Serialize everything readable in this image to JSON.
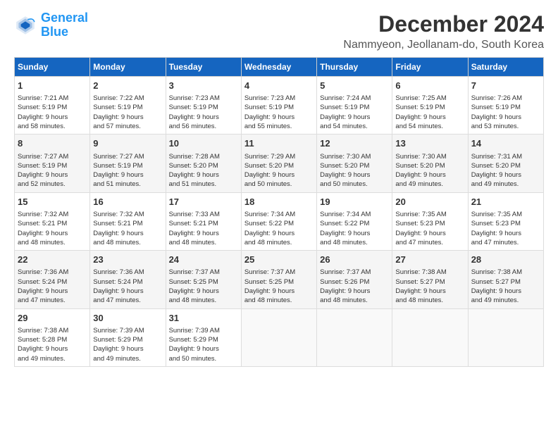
{
  "header": {
    "logo_line1": "General",
    "logo_line2": "Blue",
    "title": "December 2024",
    "subtitle": "Nammyeon, Jeollanam-do, South Korea"
  },
  "days_of_week": [
    "Sunday",
    "Monday",
    "Tuesday",
    "Wednesday",
    "Thursday",
    "Friday",
    "Saturday"
  ],
  "weeks": [
    [
      {
        "day": "1",
        "info": "Sunrise: 7:21 AM\nSunset: 5:19 PM\nDaylight: 9 hours\nand 58 minutes."
      },
      {
        "day": "2",
        "info": "Sunrise: 7:22 AM\nSunset: 5:19 PM\nDaylight: 9 hours\nand 57 minutes."
      },
      {
        "day": "3",
        "info": "Sunrise: 7:23 AM\nSunset: 5:19 PM\nDaylight: 9 hours\nand 56 minutes."
      },
      {
        "day": "4",
        "info": "Sunrise: 7:23 AM\nSunset: 5:19 PM\nDaylight: 9 hours\nand 55 minutes."
      },
      {
        "day": "5",
        "info": "Sunrise: 7:24 AM\nSunset: 5:19 PM\nDaylight: 9 hours\nand 54 minutes."
      },
      {
        "day": "6",
        "info": "Sunrise: 7:25 AM\nSunset: 5:19 PM\nDaylight: 9 hours\nand 54 minutes."
      },
      {
        "day": "7",
        "info": "Sunrise: 7:26 AM\nSunset: 5:19 PM\nDaylight: 9 hours\nand 53 minutes."
      }
    ],
    [
      {
        "day": "8",
        "info": "Sunrise: 7:27 AM\nSunset: 5:19 PM\nDaylight: 9 hours\nand 52 minutes."
      },
      {
        "day": "9",
        "info": "Sunrise: 7:27 AM\nSunset: 5:19 PM\nDaylight: 9 hours\nand 51 minutes."
      },
      {
        "day": "10",
        "info": "Sunrise: 7:28 AM\nSunset: 5:20 PM\nDaylight: 9 hours\nand 51 minutes."
      },
      {
        "day": "11",
        "info": "Sunrise: 7:29 AM\nSunset: 5:20 PM\nDaylight: 9 hours\nand 50 minutes."
      },
      {
        "day": "12",
        "info": "Sunrise: 7:30 AM\nSunset: 5:20 PM\nDaylight: 9 hours\nand 50 minutes."
      },
      {
        "day": "13",
        "info": "Sunrise: 7:30 AM\nSunset: 5:20 PM\nDaylight: 9 hours\nand 49 minutes."
      },
      {
        "day": "14",
        "info": "Sunrise: 7:31 AM\nSunset: 5:20 PM\nDaylight: 9 hours\nand 49 minutes."
      }
    ],
    [
      {
        "day": "15",
        "info": "Sunrise: 7:32 AM\nSunset: 5:21 PM\nDaylight: 9 hours\nand 48 minutes."
      },
      {
        "day": "16",
        "info": "Sunrise: 7:32 AM\nSunset: 5:21 PM\nDaylight: 9 hours\nand 48 minutes."
      },
      {
        "day": "17",
        "info": "Sunrise: 7:33 AM\nSunset: 5:21 PM\nDaylight: 9 hours\nand 48 minutes."
      },
      {
        "day": "18",
        "info": "Sunrise: 7:34 AM\nSunset: 5:22 PM\nDaylight: 9 hours\nand 48 minutes."
      },
      {
        "day": "19",
        "info": "Sunrise: 7:34 AM\nSunset: 5:22 PM\nDaylight: 9 hours\nand 48 minutes."
      },
      {
        "day": "20",
        "info": "Sunrise: 7:35 AM\nSunset: 5:23 PM\nDaylight: 9 hours\nand 47 minutes."
      },
      {
        "day": "21",
        "info": "Sunrise: 7:35 AM\nSunset: 5:23 PM\nDaylight: 9 hours\nand 47 minutes."
      }
    ],
    [
      {
        "day": "22",
        "info": "Sunrise: 7:36 AM\nSunset: 5:24 PM\nDaylight: 9 hours\nand 47 minutes."
      },
      {
        "day": "23",
        "info": "Sunrise: 7:36 AM\nSunset: 5:24 PM\nDaylight: 9 hours\nand 47 minutes."
      },
      {
        "day": "24",
        "info": "Sunrise: 7:37 AM\nSunset: 5:25 PM\nDaylight: 9 hours\nand 48 minutes."
      },
      {
        "day": "25",
        "info": "Sunrise: 7:37 AM\nSunset: 5:25 PM\nDaylight: 9 hours\nand 48 minutes."
      },
      {
        "day": "26",
        "info": "Sunrise: 7:37 AM\nSunset: 5:26 PM\nDaylight: 9 hours\nand 48 minutes."
      },
      {
        "day": "27",
        "info": "Sunrise: 7:38 AM\nSunset: 5:27 PM\nDaylight: 9 hours\nand 48 minutes."
      },
      {
        "day": "28",
        "info": "Sunrise: 7:38 AM\nSunset: 5:27 PM\nDaylight: 9 hours\nand 49 minutes."
      }
    ],
    [
      {
        "day": "29",
        "info": "Sunrise: 7:38 AM\nSunset: 5:28 PM\nDaylight: 9 hours\nand 49 minutes."
      },
      {
        "day": "30",
        "info": "Sunrise: 7:39 AM\nSunset: 5:29 PM\nDaylight: 9 hours\nand 49 minutes."
      },
      {
        "day": "31",
        "info": "Sunrise: 7:39 AM\nSunset: 5:29 PM\nDaylight: 9 hours\nand 50 minutes."
      },
      {
        "day": "",
        "info": ""
      },
      {
        "day": "",
        "info": ""
      },
      {
        "day": "",
        "info": ""
      },
      {
        "day": "",
        "info": ""
      }
    ]
  ]
}
